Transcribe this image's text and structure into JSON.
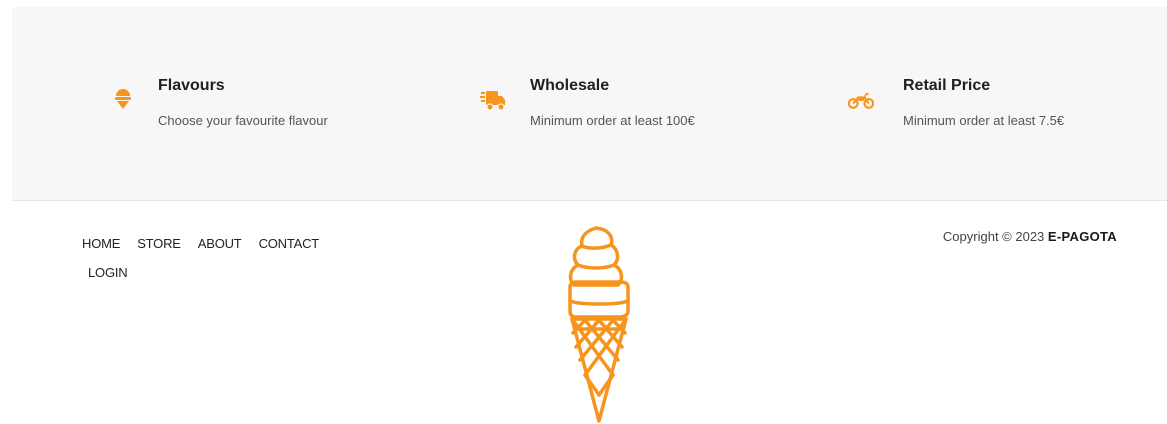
{
  "features": [
    {
      "title": "Flavours",
      "description": "Choose your favourite flavour",
      "icon": "ice-cream-icon"
    },
    {
      "title": "Wholesale",
      "description": "Minimum order at least 100€",
      "icon": "delivery-truck-icon"
    },
    {
      "title": "Retail Price",
      "description": "Minimum order at least 7.5€",
      "icon": "motorcycle-icon"
    }
  ],
  "accent_color": "#f7941d",
  "footer": {
    "nav": {
      "home": "HOME",
      "store": "STORE",
      "about": "ABOUT",
      "contact": "CONTACT",
      "login": "LOGIN"
    },
    "copyright_prefix": "Copyright © 2023",
    "brand": "E-PAGOTA",
    "logo": "ice-cream-cone-logo"
  }
}
